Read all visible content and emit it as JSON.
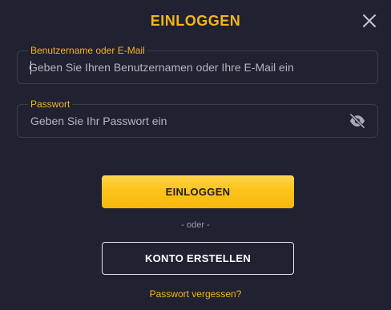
{
  "modal": {
    "title": "EINLOGGEN"
  },
  "username_field": {
    "label": "Benutzername oder E-Mail",
    "placeholder": "Geben Sie Ihren Benutzernamen oder Ihre E-Mail ein",
    "value": ""
  },
  "password_field": {
    "label": "Passwort",
    "placeholder": "Geben Sie Ihr Passwort ein",
    "value": ""
  },
  "actions": {
    "login_label": "EINLOGGEN",
    "or_label": "- oder -",
    "create_account_label": "KONTO ERSTELLEN",
    "forgot_password_label": "Passwort vergessen?"
  },
  "icons": {
    "close": "close-icon",
    "visibility": "eye-slash-icon"
  },
  "colors": {
    "accent": "#f5b61a",
    "background": "#202131",
    "button_text": "#1d1e2c"
  }
}
